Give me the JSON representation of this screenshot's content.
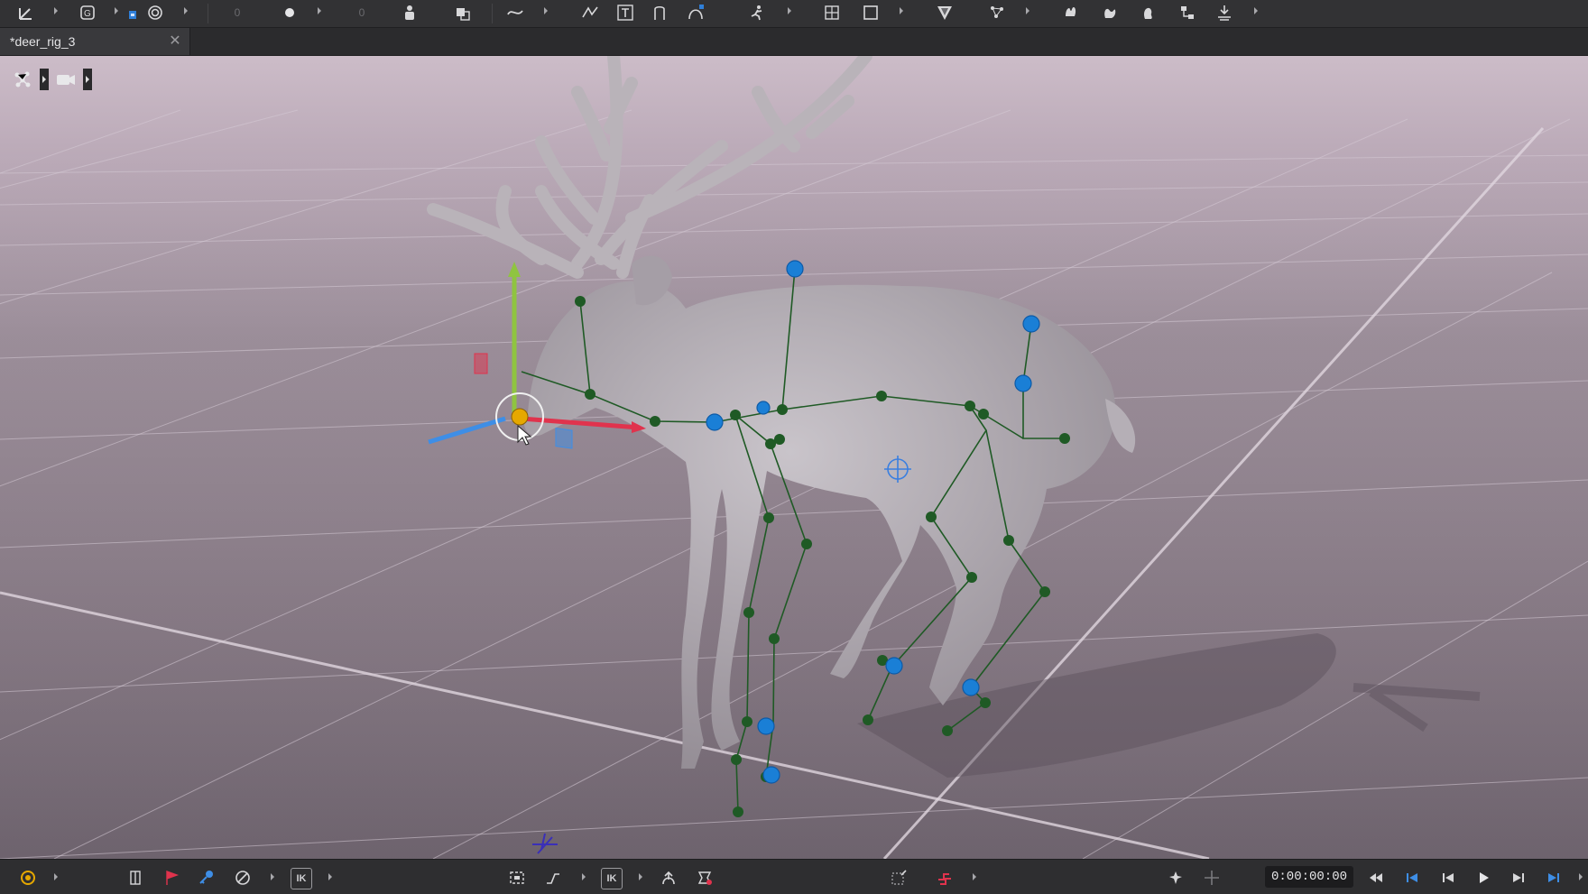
{
  "toolbar": {
    "icons": [
      "axis-tool-icon",
      "group-icon",
      "snap-icon",
      "rotate-target-icon",
      "keyframe-dot-icon",
      "character-icon",
      "blend-icon",
      "curve-icon",
      "smooth-curve-icon",
      "text-icon",
      "bracket-icon",
      "path-icon",
      "pose-icon",
      "grid-icon",
      "frame-icon",
      "mask-icon",
      "scatter-icon",
      "hand-left-icon",
      "hand-right-icon",
      "foot-icon",
      "hierarchy-icon",
      "floor-icon"
    ],
    "counter_a": "0",
    "counter_b": "0"
  },
  "tabs": [
    {
      "label": "*deer_rig_3",
      "active": true
    }
  ],
  "viewport": {
    "tools": [
      "skeleton-icon",
      "camera-icon"
    ],
    "object": "deer rig",
    "background_color": "#a5979f"
  },
  "bottombar": {
    "ik_label_a": "IK",
    "ik_label_b": "IK",
    "timecode": "0:00:00:00"
  },
  "colors": {
    "joint_green": "#1f5a25",
    "joint_blue": "#1a7fd6",
    "selected_joint": "#e6a800",
    "axis_x": "#e0334d",
    "axis_y": "#8fc440",
    "axis_z": "#3e8ee6"
  }
}
